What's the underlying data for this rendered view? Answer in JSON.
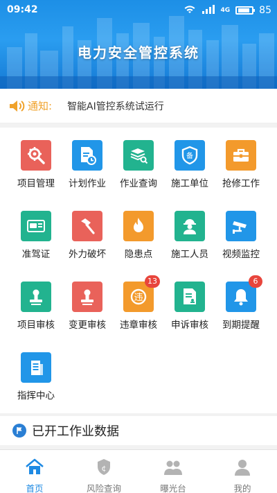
{
  "status_bar": {
    "time": "09:42",
    "network": "4G",
    "battery": "85"
  },
  "header": {
    "title": "电力安全管控系统"
  },
  "notice": {
    "label": "通知:",
    "text": "智能AI管控系统试运行"
  },
  "grid": [
    {
      "label": "项目管理",
      "icon": "gear-wrench-icon",
      "color": "#e9625a"
    },
    {
      "label": "计划作业",
      "icon": "document-clock-icon",
      "color": "#2196e8"
    },
    {
      "label": "作业查询",
      "icon": "book-search-icon",
      "color": "#22b38f"
    },
    {
      "label": "施工单位",
      "icon": "shield-icon",
      "color": "#2196e8"
    },
    {
      "label": "抢修工作",
      "icon": "toolbox-icon",
      "color": "#f39a2c"
    },
    {
      "label": "准驾证",
      "icon": "license-card-icon",
      "color": "#22b38f"
    },
    {
      "label": "外力破坏",
      "icon": "hammer-icon",
      "color": "#e9625a"
    },
    {
      "label": "隐患点",
      "icon": "fire-icon",
      "color": "#f39a2c"
    },
    {
      "label": "施工人员",
      "icon": "worker-icon",
      "color": "#22b38f"
    },
    {
      "label": "视频监控",
      "icon": "camera-icon",
      "color": "#2196e8"
    },
    {
      "label": "项目审核",
      "icon": "stamp-icon",
      "color": "#22b38f"
    },
    {
      "label": "变更审核",
      "icon": "stamp-icon",
      "color": "#e9625a"
    },
    {
      "label": "违章审核",
      "icon": "violation-icon",
      "color": "#f39a2c",
      "badge": "13"
    },
    {
      "label": "申诉审核",
      "icon": "document-stamp-icon",
      "color": "#22b38f"
    },
    {
      "label": "到期提醒",
      "icon": "bell-icon",
      "color": "#2196e8",
      "badge": "6"
    },
    {
      "label": "指挥中心",
      "icon": "building-icon",
      "color": "#2196e8"
    }
  ],
  "section": {
    "title": "已开工作业数据"
  },
  "nav": [
    {
      "label": "首页",
      "icon": "home-icon",
      "active": true
    },
    {
      "label": "风险查询",
      "icon": "risk-icon"
    },
    {
      "label": "曝光台",
      "icon": "users-icon"
    },
    {
      "label": "我的",
      "icon": "person-icon"
    }
  ],
  "colors": {
    "accent": "#1f8ae3",
    "notice": "#f0a22b",
    "badge": "#e8453c"
  }
}
